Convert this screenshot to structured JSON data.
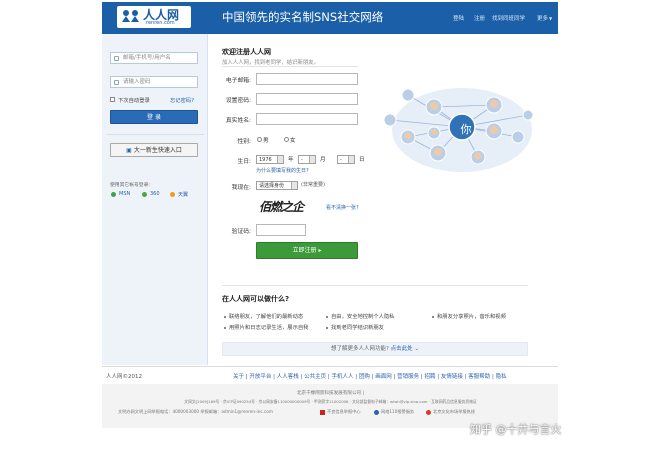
{
  "header": {
    "logo_text": "人人网",
    "logo_domain": "renren.com",
    "slogan": "中国领先的实名制SNS社交网络",
    "nav": [
      "登陆",
      "注册",
      "找到同班同学",
      "更多"
    ]
  },
  "sidebar": {
    "email_placeholder": "邮箱/手机号/用户名",
    "password_placeholder": "请输入密码",
    "remember_label": "下次自动登录",
    "forgot_label": "忘记密码?",
    "login_button": "登  录",
    "quick_button": "大一新生快速入口",
    "other_accounts_label": "使用其它帐号登录:",
    "other_accounts": [
      "MSN",
      "360",
      "天翼"
    ]
  },
  "form": {
    "title": "欢迎注册人人网",
    "subtitle": "加入人人网，找到老同学，结识新朋友。",
    "email_label": "电子邮箱:",
    "password_label": "设置密码:",
    "name_label": "真实姓名:",
    "gender_label": "性别:",
    "gender_male": "男",
    "gender_female": "女",
    "birthday_label": "生日:",
    "birth_year": "1976",
    "year_unit": "年",
    "birth_month": "-",
    "month_unit": "月",
    "birth_day": "-",
    "day_unit": "日",
    "birthday_hint": "为什么要填写我的生日?",
    "status_label": "我现在:",
    "status_select": "请选择身份",
    "status_required": "(非常重要)",
    "captcha_text": "佰燃之企",
    "captcha_refresh": "看不清换一张?",
    "captcha_label": "验证码:",
    "submit_button": "立即注册 ▸"
  },
  "network": {
    "center_label": "你"
  },
  "features": {
    "title": "在人人网可以做什么?",
    "items": [
      "联络朋友，了解他们的最新动态",
      "自由，安全地控制个人隐私",
      "和朋友分享照片，音乐和视频",
      "用照片和日志记录生活，展示自我",
      "找到老同学结识新朋友"
    ],
    "more_link_lead": "想了解更多人人网功能?",
    "more_link": "点击此处"
  },
  "footer": {
    "copyright": "人人网©2012",
    "links": [
      "关于",
      "开放平台",
      "人人客栈",
      "公共主页",
      "手机人人",
      "团购",
      "画面网",
      "营销服务",
      "招聘",
      "友情链接",
      "客服帮助",
      "隐私"
    ],
    "company": "北京千橡网景科技发展有限公司 |",
    "line1": "文网文[2009]169号 · 京ICP证090254号 · 京公网安备110000000009号 · 甲测资字11002006 · 文化部监督电子邮箱：wlwh@vip.sina.com · 互联网药品信息服务资格证",
    "line2": "文明办网文明上网举报电话：4000003000 举报邮箱：admin1@renren-inc.com",
    "badge1": "不良信息举报中心",
    "badge2": "网络110报警服务",
    "badge3": "北京文化市场举报热线"
  },
  "watermark": "知乎 @十井与言火",
  "colors": {
    "header_blue": "#1b5fa8",
    "submit_green": "#3c9a3a",
    "link_blue": "#2a62ae"
  }
}
